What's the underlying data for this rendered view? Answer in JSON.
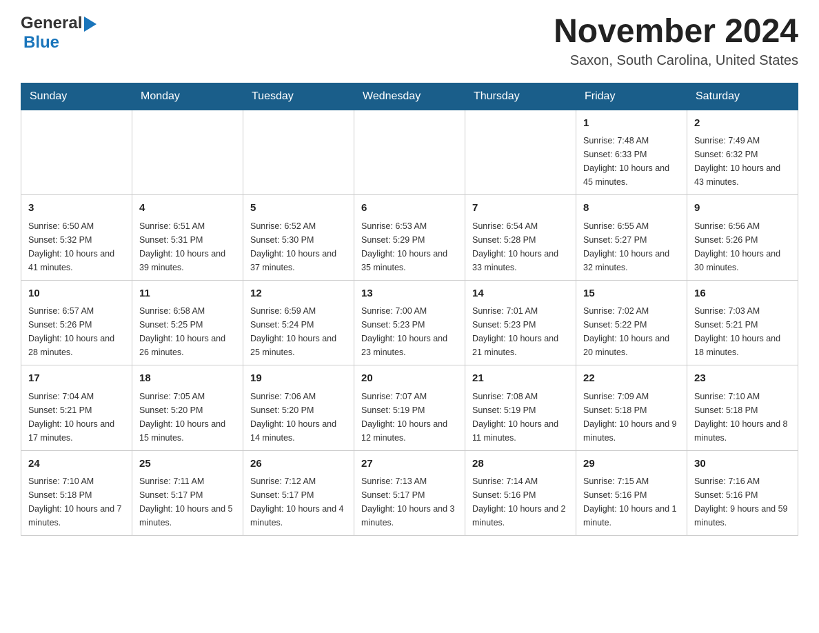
{
  "header": {
    "logo_general": "General",
    "logo_blue": "Blue",
    "month_title": "November 2024",
    "location": "Saxon, South Carolina, United States"
  },
  "days_of_week": [
    "Sunday",
    "Monday",
    "Tuesday",
    "Wednesday",
    "Thursday",
    "Friday",
    "Saturday"
  ],
  "weeks": [
    [
      {
        "day": "",
        "sunrise": "",
        "sunset": "",
        "daylight": ""
      },
      {
        "day": "",
        "sunrise": "",
        "sunset": "",
        "daylight": ""
      },
      {
        "day": "",
        "sunrise": "",
        "sunset": "",
        "daylight": ""
      },
      {
        "day": "",
        "sunrise": "",
        "sunset": "",
        "daylight": ""
      },
      {
        "day": "",
        "sunrise": "",
        "sunset": "",
        "daylight": ""
      },
      {
        "day": "1",
        "sunrise": "Sunrise: 7:48 AM",
        "sunset": "Sunset: 6:33 PM",
        "daylight": "Daylight: 10 hours and 45 minutes."
      },
      {
        "day": "2",
        "sunrise": "Sunrise: 7:49 AM",
        "sunset": "Sunset: 6:32 PM",
        "daylight": "Daylight: 10 hours and 43 minutes."
      }
    ],
    [
      {
        "day": "3",
        "sunrise": "Sunrise: 6:50 AM",
        "sunset": "Sunset: 5:32 PM",
        "daylight": "Daylight: 10 hours and 41 minutes."
      },
      {
        "day": "4",
        "sunrise": "Sunrise: 6:51 AM",
        "sunset": "Sunset: 5:31 PM",
        "daylight": "Daylight: 10 hours and 39 minutes."
      },
      {
        "day": "5",
        "sunrise": "Sunrise: 6:52 AM",
        "sunset": "Sunset: 5:30 PM",
        "daylight": "Daylight: 10 hours and 37 minutes."
      },
      {
        "day": "6",
        "sunrise": "Sunrise: 6:53 AM",
        "sunset": "Sunset: 5:29 PM",
        "daylight": "Daylight: 10 hours and 35 minutes."
      },
      {
        "day": "7",
        "sunrise": "Sunrise: 6:54 AM",
        "sunset": "Sunset: 5:28 PM",
        "daylight": "Daylight: 10 hours and 33 minutes."
      },
      {
        "day": "8",
        "sunrise": "Sunrise: 6:55 AM",
        "sunset": "Sunset: 5:27 PM",
        "daylight": "Daylight: 10 hours and 32 minutes."
      },
      {
        "day": "9",
        "sunrise": "Sunrise: 6:56 AM",
        "sunset": "Sunset: 5:26 PM",
        "daylight": "Daylight: 10 hours and 30 minutes."
      }
    ],
    [
      {
        "day": "10",
        "sunrise": "Sunrise: 6:57 AM",
        "sunset": "Sunset: 5:26 PM",
        "daylight": "Daylight: 10 hours and 28 minutes."
      },
      {
        "day": "11",
        "sunrise": "Sunrise: 6:58 AM",
        "sunset": "Sunset: 5:25 PM",
        "daylight": "Daylight: 10 hours and 26 minutes."
      },
      {
        "day": "12",
        "sunrise": "Sunrise: 6:59 AM",
        "sunset": "Sunset: 5:24 PM",
        "daylight": "Daylight: 10 hours and 25 minutes."
      },
      {
        "day": "13",
        "sunrise": "Sunrise: 7:00 AM",
        "sunset": "Sunset: 5:23 PM",
        "daylight": "Daylight: 10 hours and 23 minutes."
      },
      {
        "day": "14",
        "sunrise": "Sunrise: 7:01 AM",
        "sunset": "Sunset: 5:23 PM",
        "daylight": "Daylight: 10 hours and 21 minutes."
      },
      {
        "day": "15",
        "sunrise": "Sunrise: 7:02 AM",
        "sunset": "Sunset: 5:22 PM",
        "daylight": "Daylight: 10 hours and 20 minutes."
      },
      {
        "day": "16",
        "sunrise": "Sunrise: 7:03 AM",
        "sunset": "Sunset: 5:21 PM",
        "daylight": "Daylight: 10 hours and 18 minutes."
      }
    ],
    [
      {
        "day": "17",
        "sunrise": "Sunrise: 7:04 AM",
        "sunset": "Sunset: 5:21 PM",
        "daylight": "Daylight: 10 hours and 17 minutes."
      },
      {
        "day": "18",
        "sunrise": "Sunrise: 7:05 AM",
        "sunset": "Sunset: 5:20 PM",
        "daylight": "Daylight: 10 hours and 15 minutes."
      },
      {
        "day": "19",
        "sunrise": "Sunrise: 7:06 AM",
        "sunset": "Sunset: 5:20 PM",
        "daylight": "Daylight: 10 hours and 14 minutes."
      },
      {
        "day": "20",
        "sunrise": "Sunrise: 7:07 AM",
        "sunset": "Sunset: 5:19 PM",
        "daylight": "Daylight: 10 hours and 12 minutes."
      },
      {
        "day": "21",
        "sunrise": "Sunrise: 7:08 AM",
        "sunset": "Sunset: 5:19 PM",
        "daylight": "Daylight: 10 hours and 11 minutes."
      },
      {
        "day": "22",
        "sunrise": "Sunrise: 7:09 AM",
        "sunset": "Sunset: 5:18 PM",
        "daylight": "Daylight: 10 hours and 9 minutes."
      },
      {
        "day": "23",
        "sunrise": "Sunrise: 7:10 AM",
        "sunset": "Sunset: 5:18 PM",
        "daylight": "Daylight: 10 hours and 8 minutes."
      }
    ],
    [
      {
        "day": "24",
        "sunrise": "Sunrise: 7:10 AM",
        "sunset": "Sunset: 5:18 PM",
        "daylight": "Daylight: 10 hours and 7 minutes."
      },
      {
        "day": "25",
        "sunrise": "Sunrise: 7:11 AM",
        "sunset": "Sunset: 5:17 PM",
        "daylight": "Daylight: 10 hours and 5 minutes."
      },
      {
        "day": "26",
        "sunrise": "Sunrise: 7:12 AM",
        "sunset": "Sunset: 5:17 PM",
        "daylight": "Daylight: 10 hours and 4 minutes."
      },
      {
        "day": "27",
        "sunrise": "Sunrise: 7:13 AM",
        "sunset": "Sunset: 5:17 PM",
        "daylight": "Daylight: 10 hours and 3 minutes."
      },
      {
        "day": "28",
        "sunrise": "Sunrise: 7:14 AM",
        "sunset": "Sunset: 5:16 PM",
        "daylight": "Daylight: 10 hours and 2 minutes."
      },
      {
        "day": "29",
        "sunrise": "Sunrise: 7:15 AM",
        "sunset": "Sunset: 5:16 PM",
        "daylight": "Daylight: 10 hours and 1 minute."
      },
      {
        "day": "30",
        "sunrise": "Sunrise: 7:16 AM",
        "sunset": "Sunset: 5:16 PM",
        "daylight": "Daylight: 9 hours and 59 minutes."
      }
    ]
  ]
}
